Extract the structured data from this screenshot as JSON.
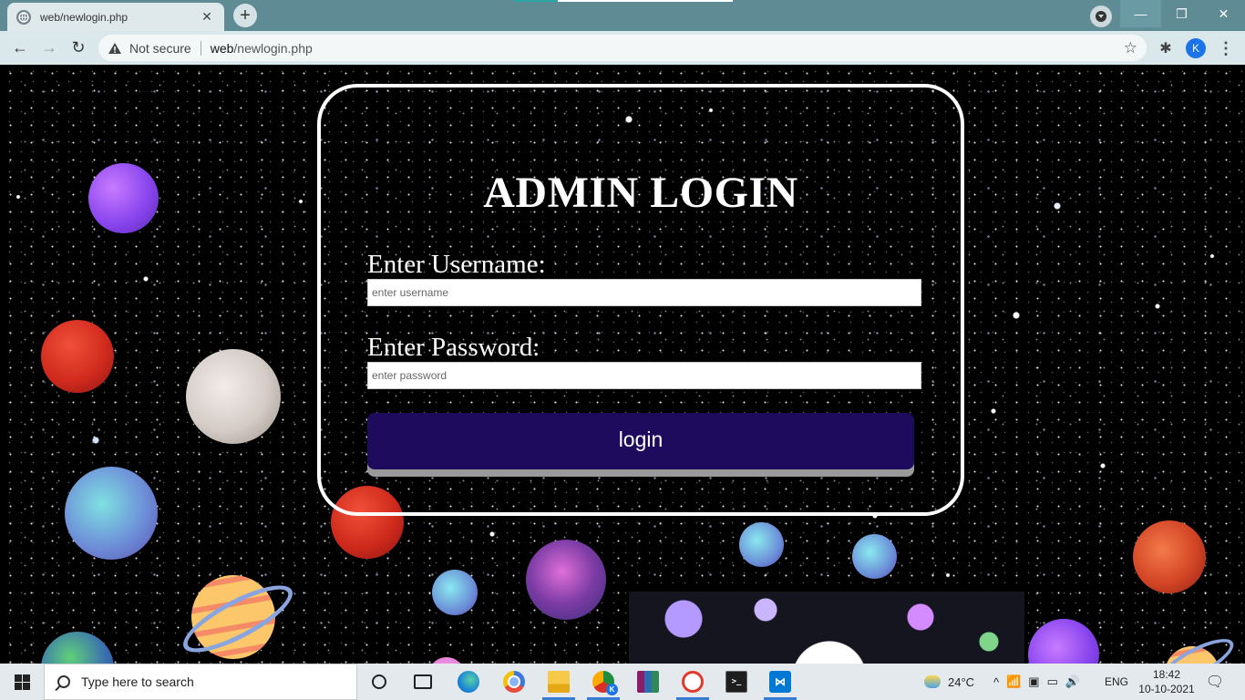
{
  "browser": {
    "tab_title": "web/newlogin.php",
    "tab_close": "✕",
    "new_tab": "+",
    "security_label": "Not secure",
    "url_host": "web",
    "url_path": "/newlogin.php",
    "profile_initial": "K",
    "window_controls": {
      "minimize": "—",
      "maximize": "❐",
      "close": "✕"
    },
    "nav": {
      "back": "←",
      "forward": "→",
      "reload": "↻",
      "bookmark": "☆",
      "extensions": "✱",
      "menu": "⋮"
    }
  },
  "login": {
    "title": "ADMIN LOGIN",
    "username_label": "Enter Username:",
    "username_placeholder": "enter username",
    "username_value": "",
    "password_label": "Enter Password:",
    "password_placeholder": "enter password",
    "password_value": "",
    "button_label": "login",
    "button_color": "#1f0b5e"
  },
  "taskbar": {
    "search_placeholder": "Type here to search",
    "pinned_icons": [
      "cortana-icon",
      "task-view-icon",
      "edge-icon",
      "chrome-icon",
      "file-explorer-icon",
      "chrome-profile-icon",
      "winrar-icon",
      "paint-icon",
      "terminal-icon",
      "vscode-icon"
    ],
    "chrome_profile_badge": "K",
    "weather": "24°C",
    "tray_chevron": "^",
    "language": "ENG",
    "time": "18:42",
    "date": "10-10-2021"
  },
  "colors": {
    "chrome_frame": "#5f8b95",
    "toolbar": "#dbe8eb",
    "taskbar": "#e4e9ee",
    "accent": "#3a7bd5"
  }
}
